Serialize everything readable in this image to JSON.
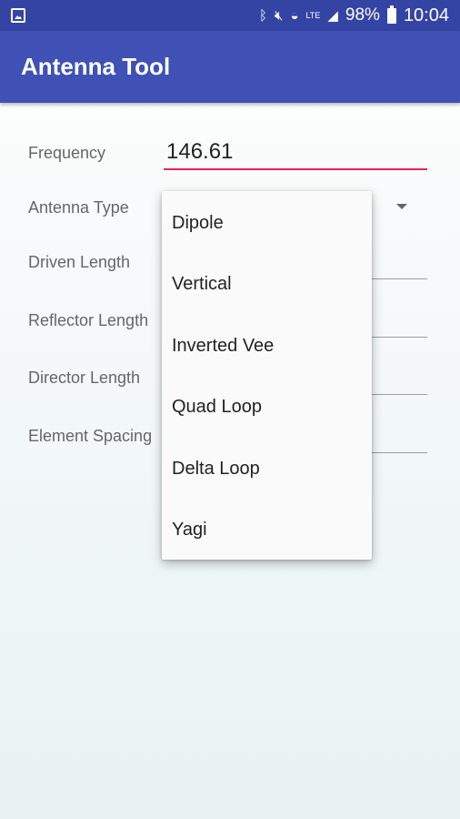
{
  "status_bar": {
    "battery": "98%",
    "time": "10:04",
    "icons": [
      "gallery-icon",
      "bluetooth-icon",
      "mute-icon",
      "wifi-icon",
      "lte-icon",
      "signal-icon",
      "battery-icon"
    ]
  },
  "app_bar": {
    "title": "Antenna Tool"
  },
  "form": {
    "frequency_label": "Frequency",
    "frequency_value": "146.61",
    "antenna_type_label": "Antenna Type",
    "driven_length_label": "Driven Length",
    "reflector_length_label": "Reflector Length",
    "director_length_label": "Director Length",
    "element_spacing_label": "Element Spacing"
  },
  "dropdown": {
    "options": [
      "Dipole",
      "Vertical",
      "Inverted Vee",
      "Quad Loop",
      "Delta Loop",
      "Yagi"
    ]
  },
  "colors": {
    "status_bar": "#3444a5",
    "app_bar": "#3f51b5",
    "accent": "#e91e63"
  }
}
